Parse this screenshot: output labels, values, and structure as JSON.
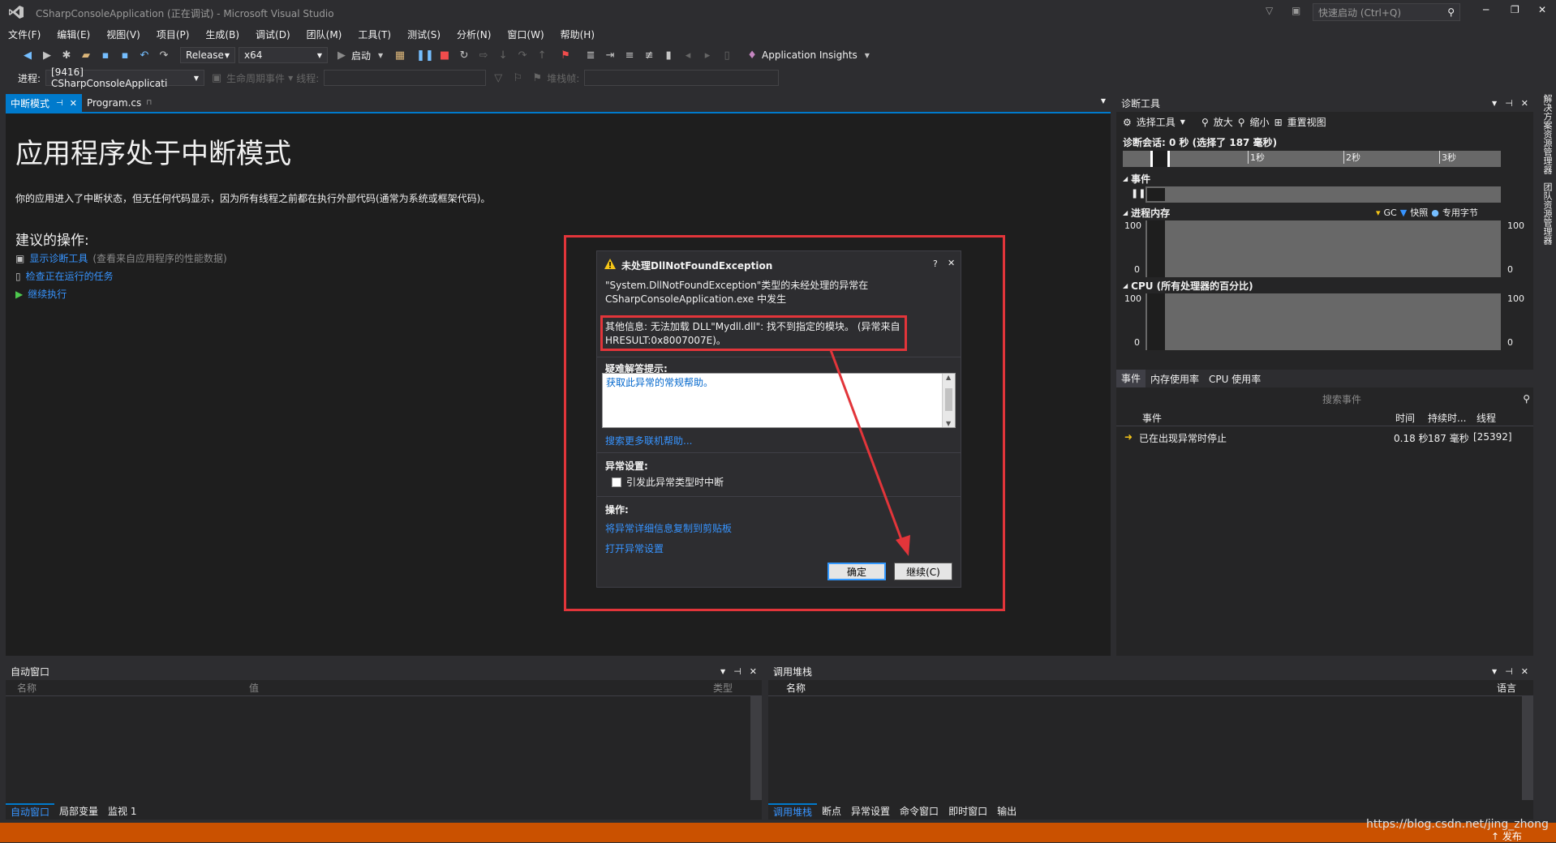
{
  "window": {
    "title": "CSharpConsoleApplication (正在调试) - Microsoft Visual Studio",
    "quick_launch_placeholder": "快速启动 (Ctrl+Q)"
  },
  "menu": [
    "文件(F)",
    "编辑(E)",
    "视图(V)",
    "项目(P)",
    "生成(B)",
    "调试(D)",
    "团队(M)",
    "工具(T)",
    "测试(S)",
    "分析(N)",
    "窗口(W)",
    "帮助(H)"
  ],
  "toolbar": {
    "config": "Release",
    "platform": "x64",
    "start_label": "启动",
    "app_insights": "Application Insights"
  },
  "debug_toolbar": {
    "process_label": "进程:",
    "process_value": "[9416] CSharpConsoleApplicati",
    "lifecycle_label": "生命周期事件",
    "thread_label": "线程:",
    "stackframe_label": "堆栈帧:"
  },
  "tabs": {
    "break_mode": "中断模式",
    "program": "Program.cs"
  },
  "break_page": {
    "title": "应用程序处于中断模式",
    "description": "你的应用进入了中断状态，但无任何代码显示，因为所有线程之前都在执行外部代码(通常为系统或框架代码)。",
    "suggested": "建议的操作:",
    "actions": [
      {
        "link": "显示诊断工具",
        "note": "(查看来自应用程序的性能数据)"
      },
      {
        "link": "检查正在运行的任务",
        "note": ""
      },
      {
        "link": "继续执行",
        "note": ""
      }
    ]
  },
  "dialog": {
    "title": "未处理DllNotFoundException",
    "message_line1": "\"System.DllNotFoundException\"类型的未经处理的异常在",
    "message_line2": "CSharpConsoleApplication.exe 中发生",
    "info_line1": "其他信息: 无法加载 DLL\"Mydll.dll\": 找不到指定的模块。 (异常来自",
    "info_line2": "HRESULT:0x8007007E)。",
    "troubleshoot_label": "疑难解答提示:",
    "troubleshoot_link": "获取此异常的常规帮助。",
    "search_online": "搜索更多联机帮助...",
    "settings_label": "异常设置:",
    "break_checkbox": "引发此异常类型时中断",
    "actions_label": "操作:",
    "copy_link": "将异常详细信息复制到剪贴板",
    "open_settings_link": "打开异常设置",
    "ok_button": "确定",
    "continue_button": "继续(C)",
    "help_glyph": "?",
    "close_glyph": "✕"
  },
  "diagnostics": {
    "panel_title": "诊断工具",
    "select_tool": "选择工具",
    "zoom_in": "放大",
    "zoom_out": "缩小",
    "reset_view": "重置视图",
    "session": "诊断会话: 0 秒 (选择了 187 毫秒)",
    "ticks": [
      "1秒",
      "2秒",
      "3秒"
    ],
    "events_label": "事件",
    "memory_label": "进程内存",
    "legend": [
      "GC",
      "快照",
      "专用字节"
    ],
    "cpu_label": "CPU (所有处理器的百分比)",
    "axis_100": "100",
    "axis_0": "0",
    "bottom_tabs": [
      "事件",
      "内存使用率",
      "CPU 使用率"
    ],
    "search_placeholder": "搜索事件",
    "columns": [
      "事件",
      "时间",
      "持续时...",
      "线程"
    ],
    "event_row": {
      "name": "已在出现异常时停止",
      "time": "0.18 秒",
      "duration": "187 毫秒",
      "thread": "[25392]"
    }
  },
  "side_tabs": [
    "解决方案资源管理器",
    "团队资源管理器"
  ],
  "autos": {
    "title": "自动窗口",
    "columns": [
      "名称",
      "值",
      "类型"
    ],
    "tabs": [
      "自动窗口",
      "局部变量",
      "监视 1"
    ]
  },
  "callstack": {
    "title": "调用堆栈",
    "columns": [
      "名称",
      "语言"
    ],
    "tabs": [
      "调用堆栈",
      "断点",
      "异常设置",
      "命令窗口",
      "即时窗口",
      "输出"
    ]
  },
  "status": {
    "publish": "↑ 发布",
    "watermark": "https://blog.csdn.net/jing_zhong"
  },
  "colors": {
    "accent": "#007acc",
    "status": "#ca5100",
    "highlight_box": "#e2353a"
  }
}
